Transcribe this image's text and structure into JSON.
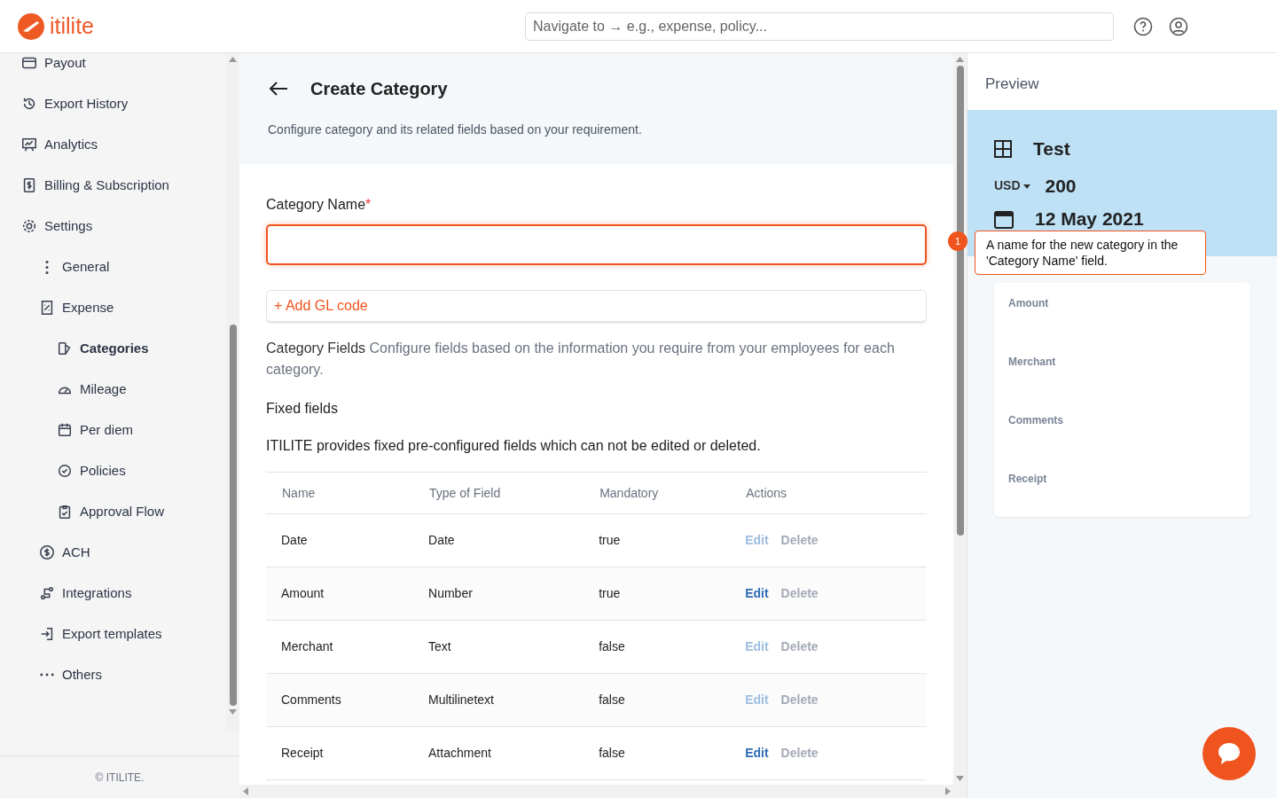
{
  "header": {
    "logo": "itilite",
    "search": {
      "placeholder": "Navigate to → e.g., expense, policy..."
    }
  },
  "sidebar": {
    "items": [
      {
        "label": "Payout",
        "selected": false
      },
      {
        "label": "Export History",
        "selected": false
      },
      {
        "label": "Analytics",
        "selected": false
      },
      {
        "label": "Billing & Subscription",
        "selected": false
      },
      {
        "label": "Settings",
        "selected": false,
        "children": [
          {
            "label": "General",
            "selected": false
          },
          {
            "label": "Expense",
            "selected": false,
            "children": [
              {
                "label": "Categories",
                "selected": true
              },
              {
                "label": "Mileage",
                "selected": false
              },
              {
                "label": "Per diem",
                "selected": false
              },
              {
                "label": "Policies",
                "selected": false
              },
              {
                "label": "Approval Flow",
                "selected": false
              }
            ]
          },
          {
            "label": "ACH",
            "selected": false
          },
          {
            "label": "Integrations",
            "selected": false
          },
          {
            "label": "Export templates",
            "selected": false
          },
          {
            "label": "Others",
            "selected": false
          }
        ]
      }
    ],
    "footer": "© ITILITE."
  },
  "page": {
    "title": "Create Category",
    "subtitle": "Configure category and its related fields based on your requirement.",
    "name_label": "Category Name",
    "required_mark": "*",
    "add_gl": "Add GL code",
    "add_icon": "+",
    "fields_title": "Category Fields",
    "fields_desc": "Configure fields based on the information you require from your employees for each category.",
    "fixed_title": "Fixed fields",
    "fixed_desc": "ITILITE provides fixed pre-configured fields which can not be edited or deleted.",
    "table": {
      "columns": [
        "Name",
        "Type of Field",
        "Mandatory",
        "Actions"
      ],
      "rows": [
        {
          "name": "Date",
          "type": "Date",
          "mandatory": "true",
          "edit": "Edit",
          "edit_enabled": false,
          "delete": "Delete",
          "delete_enabled": false
        },
        {
          "name": "Amount",
          "type": "Number",
          "mandatory": "true",
          "edit": "Edit",
          "edit_enabled": true,
          "delete": "Delete",
          "delete_enabled": false
        },
        {
          "name": "Merchant",
          "type": "Text",
          "mandatory": "false",
          "edit": "Edit",
          "edit_enabled": false,
          "delete": "Delete",
          "delete_enabled": false
        },
        {
          "name": "Comments",
          "type": "Multilinetext",
          "mandatory": "false",
          "edit": "Edit",
          "edit_enabled": false,
          "delete": "Delete",
          "delete_enabled": false
        },
        {
          "name": "Receipt",
          "type": "Attachment",
          "mandatory": "false",
          "edit": "Edit",
          "edit_enabled": true,
          "delete": "Delete",
          "delete_enabled": false
        }
      ]
    }
  },
  "preview": {
    "title": "Preview",
    "category": "Test",
    "currency": "USD",
    "amount": "200",
    "date": "12 May 2021",
    "fields": [
      "Amount",
      "Merchant",
      "Comments",
      "Receipt"
    ]
  },
  "tooltip": {
    "step": "1",
    "text": "A name for the new category in the 'Category Name' field."
  }
}
